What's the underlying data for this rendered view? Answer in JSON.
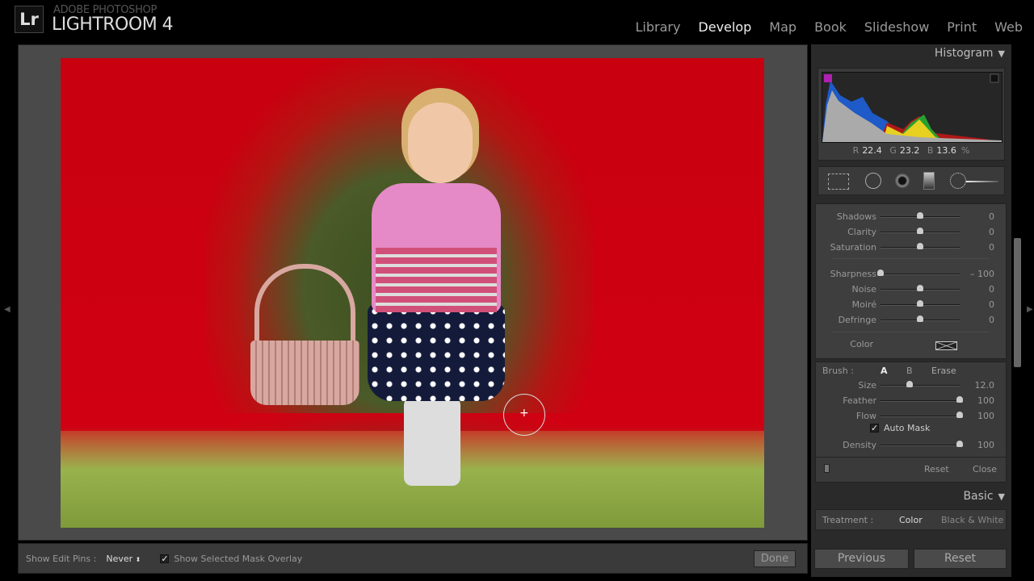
{
  "app": {
    "logo": "Lr",
    "brand_small": "ADOBE PHOTOSHOP",
    "brand_big": "LIGHTROOM 4"
  },
  "modules": [
    {
      "label": "Library"
    },
    {
      "label": "Develop",
      "active": true
    },
    {
      "label": "Map"
    },
    {
      "label": "Book"
    },
    {
      "label": "Slideshow"
    },
    {
      "label": "Print"
    },
    {
      "label": "Web"
    }
  ],
  "toolbar": {
    "edit_pins_label": "Show Edit Pins :",
    "edit_pins_value": "Never",
    "mask_overlay_label": "Show Selected Mask Overlay",
    "mask_overlay_checked": true,
    "done": "Done"
  },
  "histogram": {
    "title": "Histogram",
    "r_label": "R",
    "r": "22.4",
    "g_label": "G",
    "g": "23.2",
    "b_label": "B",
    "b": "13.6",
    "unit": "%"
  },
  "adjustments": [
    {
      "label": "Shadows",
      "value": "0",
      "level": 0.5
    },
    {
      "label": "Clarity",
      "value": "0",
      "level": 0.5
    },
    {
      "label": "Saturation",
      "value": "0",
      "level": 0.5
    },
    {
      "label": "Sharpness",
      "value": "– 100",
      "level": 0.0
    },
    {
      "label": "Noise",
      "value": "0",
      "level": 0.5
    },
    {
      "label": "Moiré",
      "value": "0",
      "level": 0.5
    },
    {
      "label": "Defringe",
      "value": "0",
      "level": 0.5
    }
  ],
  "color_label": "Color",
  "brush": {
    "label": "Brush :",
    "a": "A",
    "b": "B",
    "erase": "Erase",
    "sliders": [
      {
        "label": "Size",
        "value": "12.0",
        "level": 0.37
      },
      {
        "label": "Feather",
        "value": "100",
        "level": 1
      },
      {
        "label": "Flow",
        "value": "100",
        "level": 1
      }
    ],
    "auto_mask": "Auto Mask",
    "auto_mask_checked": true,
    "density": {
      "label": "Density",
      "value": "100",
      "level": 1
    },
    "reset": "Reset",
    "close": "Close"
  },
  "basic": {
    "title": "Basic",
    "treatment_label": "Treatment :",
    "color": "Color",
    "bw": "Black & White"
  },
  "buttons": {
    "previous": "Previous",
    "reset": "Reset"
  }
}
